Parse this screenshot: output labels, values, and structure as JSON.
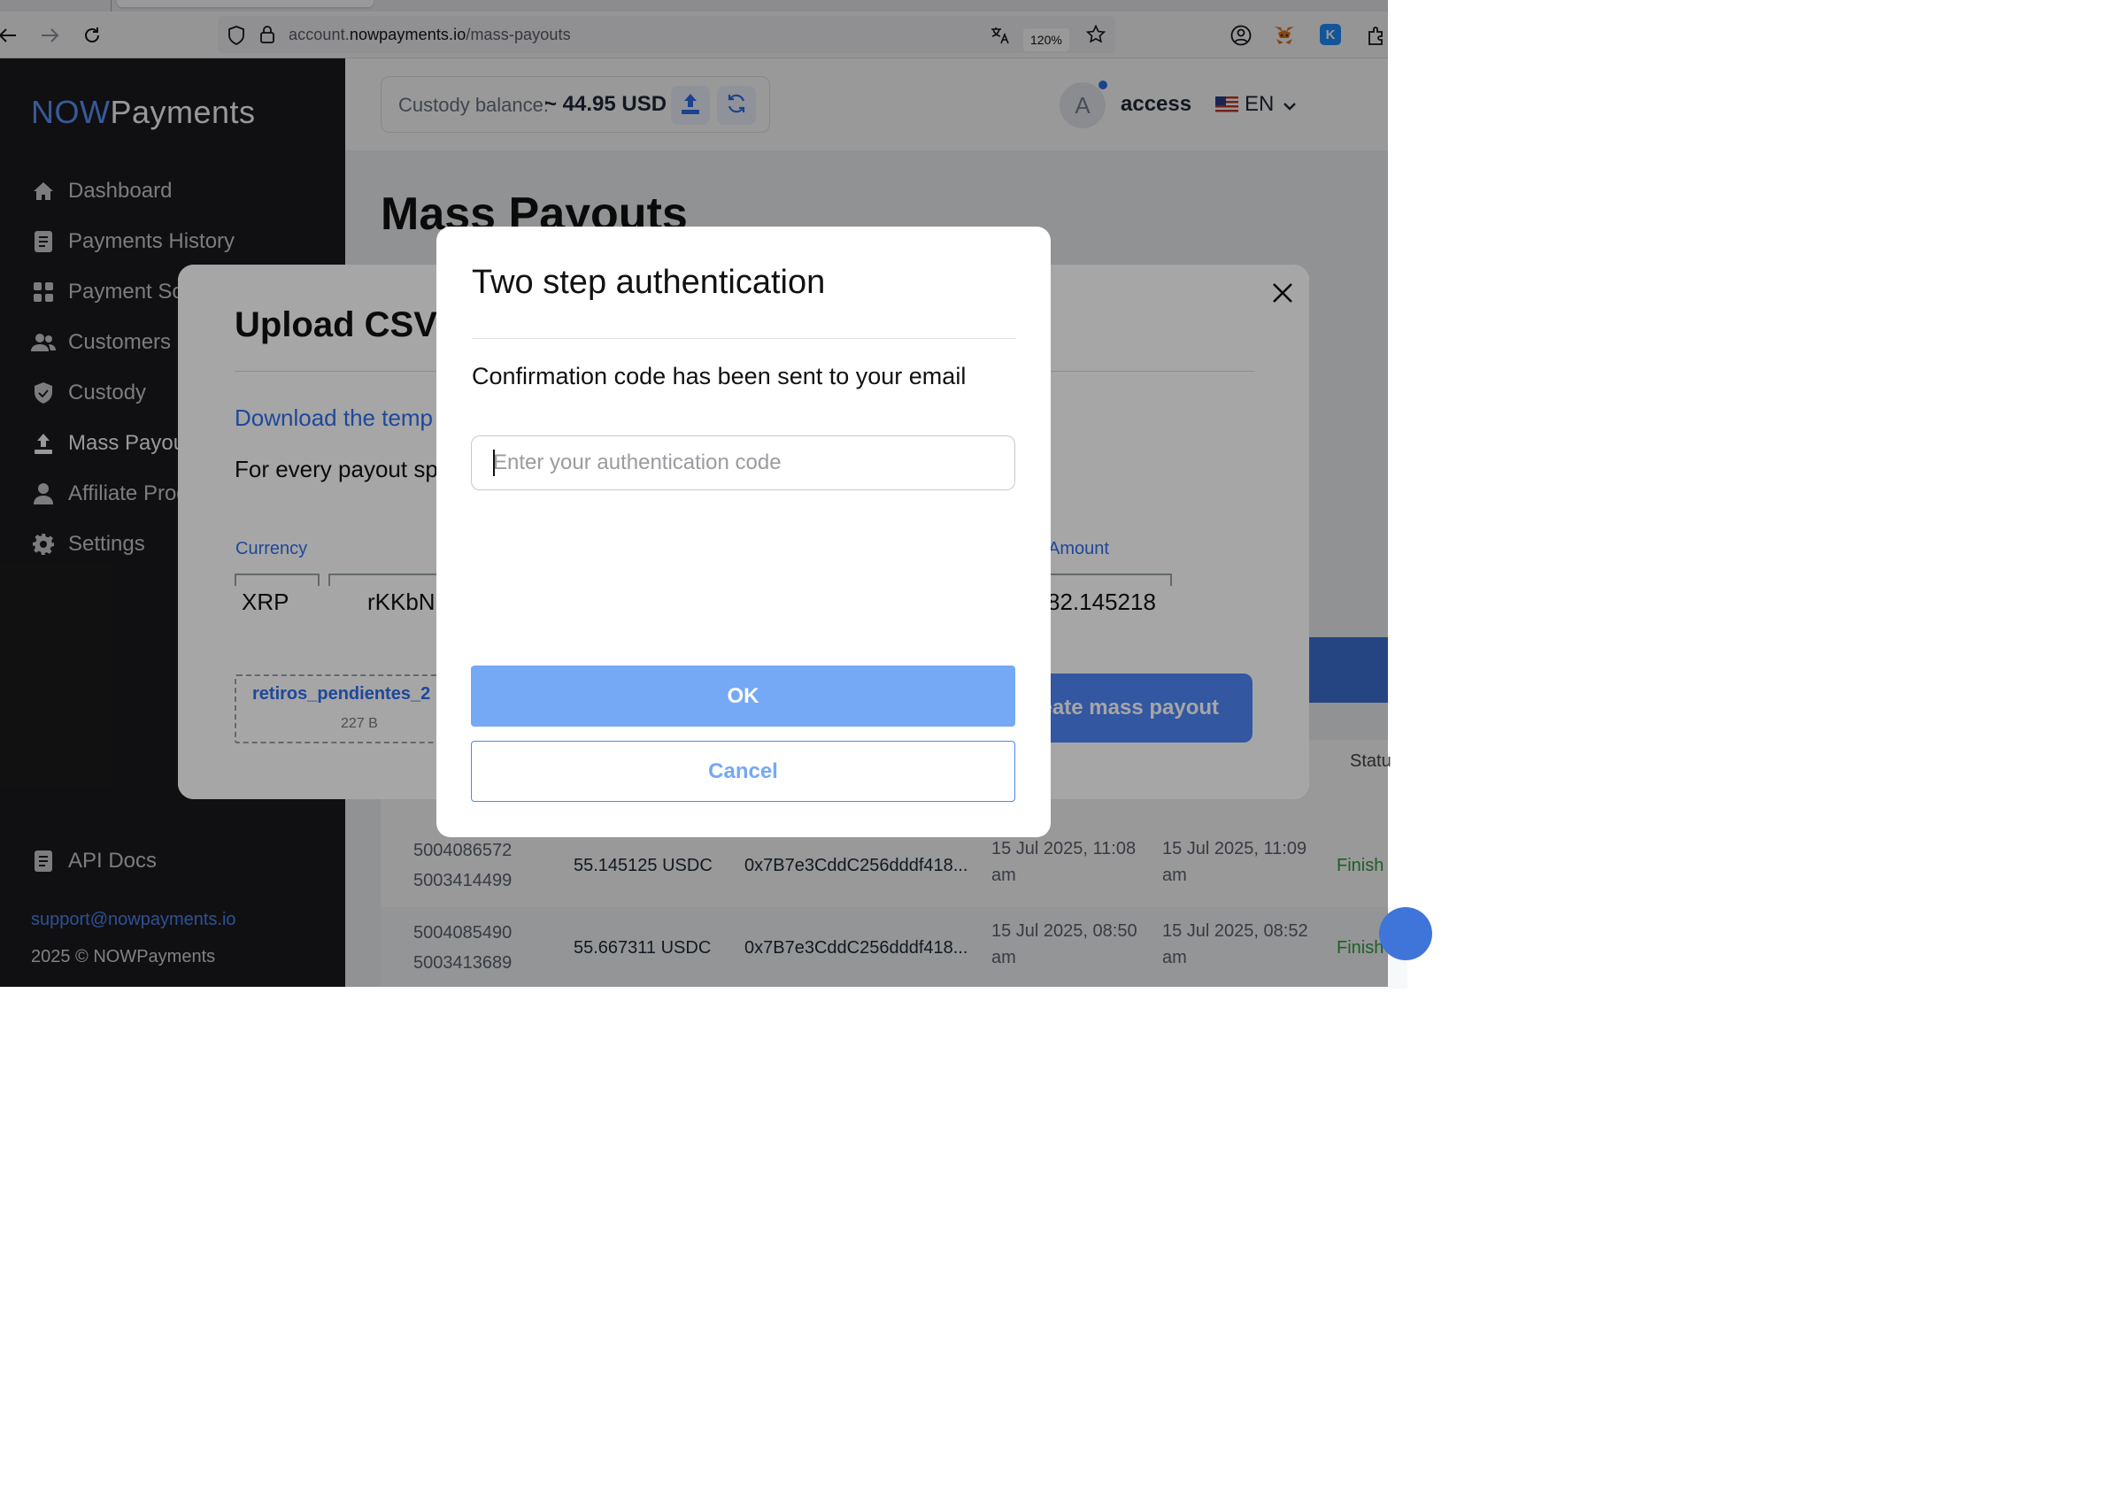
{
  "browser": {
    "url_prefix": "account.",
    "url_domain": "nowpayments.io",
    "url_path": "/mass-payouts",
    "zoom": "120%"
  },
  "sidebar": {
    "logo_now": "NOW",
    "logo_payments": "Payments",
    "items": [
      {
        "label": "Dashboard",
        "icon": "home-icon"
      },
      {
        "label": "Payments History",
        "icon": "document-icon"
      },
      {
        "label": "Payment So",
        "icon": "grid-icon"
      },
      {
        "label": "Customers",
        "icon": "users-icon"
      },
      {
        "label": "Custody",
        "icon": "shield-icon"
      },
      {
        "label": "Mass Payout",
        "icon": "upload-icon"
      },
      {
        "label": "Affiliate Prog",
        "icon": "person-icon"
      },
      {
        "label": "Settings",
        "icon": "gear-icon"
      }
    ],
    "api_docs": "API Docs",
    "support_email": "support@nowpayments.io",
    "copyright": "2025 © NOWPayments"
  },
  "header": {
    "balance_label": "Custody balance:",
    "balance_value": "~ 44.95 USD",
    "avatar_letter": "A",
    "account_name": "access",
    "language": "EN"
  },
  "page": {
    "title": "Mass Payouts",
    "status_header": "Statu",
    "rows": [
      {
        "id1": "5004086572",
        "id2": "5003414499",
        "amount": "55.145125 USDC",
        "address": "0x7B7e3CddC256dddf418...",
        "created_1": "15 Jul 2025, 11:08",
        "created_2": "am",
        "updated_1": "15 Jul 2025, 11:09",
        "updated_2": "am",
        "status": "Finish"
      },
      {
        "id1": "5004085490",
        "id2": "5003413689",
        "amount": "55.667311 USDC",
        "address": "0x7B7e3CddC256dddf418...",
        "created_1": "15 Jul 2025, 08:50",
        "created_2": "am",
        "updated_1": "15 Jul 2025, 08:52",
        "updated_2": "am",
        "status": "Finish"
      }
    ]
  },
  "upload_modal": {
    "title": "Upload CSV",
    "download_link": "Download the temp",
    "description": "For every payout sp",
    "col_currency": "Currency",
    "col_amount": "Amount",
    "row_currency": "XRP",
    "row_address": "rKKbN",
    "row_amount": "82.145218",
    "file_name": "retiros_pendientes_2",
    "file_size": "227 B",
    "create_button": "eate mass payout"
  },
  "auth_modal": {
    "title": "Two step authentication",
    "message": "Confirmation code has been sent to your email",
    "input_placeholder": "Enter your authentication code",
    "input_value": "",
    "ok_label": "OK",
    "cancel_label": "Cancel"
  },
  "colors": {
    "brand_blue": "#4f86f7",
    "sidebar_bg": "#1c1c1e",
    "ok_button": "#75a8f5",
    "status_finished": "#2ea043"
  }
}
